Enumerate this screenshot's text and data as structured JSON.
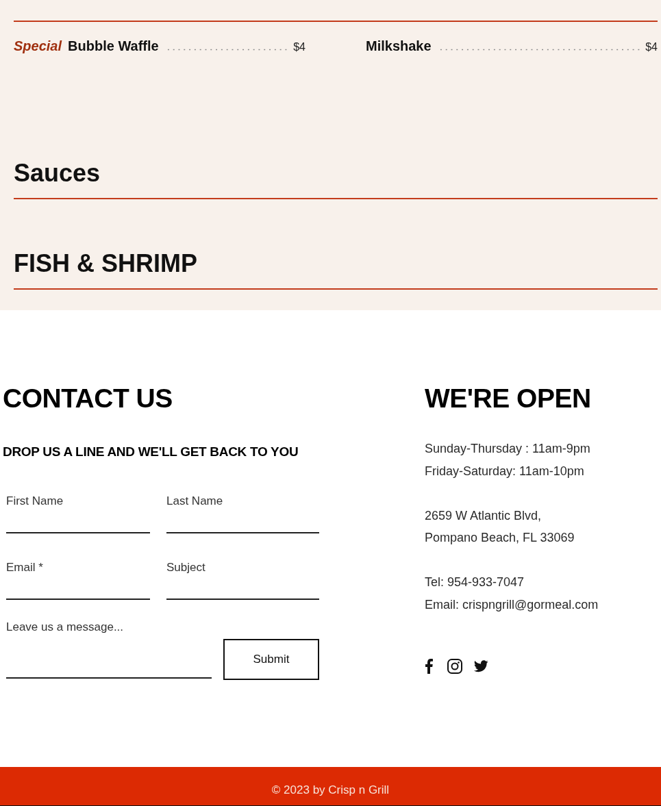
{
  "menu": {
    "sections": [
      {
        "items": [
          {
            "tag": "Special",
            "name": "Bubble Waffle",
            "price": "$4"
          },
          {
            "name": "Milkshake",
            "price": "$4"
          }
        ]
      },
      {
        "title": "Sauces"
      },
      {
        "title": "FISH & SHRIMP"
      }
    ]
  },
  "contact": {
    "title": "CONTACT US",
    "subtitle": "DROP US A LINE AND WE'LL GET BACK TO YOU",
    "fields": [
      {
        "label": "First Name"
      },
      {
        "label": "Last Name"
      },
      {
        "label": "Email *"
      },
      {
        "label": "Subject"
      }
    ],
    "message": {
      "placeholder": "Leave us a message..."
    },
    "submit": "Submit"
  },
  "info": {
    "title": "WE'RE OPEN",
    "blocks": [
      [
        "Sunday-Thursday : 11am-9pm",
        "Friday-Saturday: 11am-10pm"
      ],
      [
        "2659 W Atlantic Blvd,",
        "Pompano Beach, FL 33069"
      ],
      [
        "Tel: 954-933-7047",
        "Email: crispngrill@gormeal.com"
      ]
    ]
  },
  "footer": {
    "text": "© 2023 by Crisp n Grill"
  }
}
